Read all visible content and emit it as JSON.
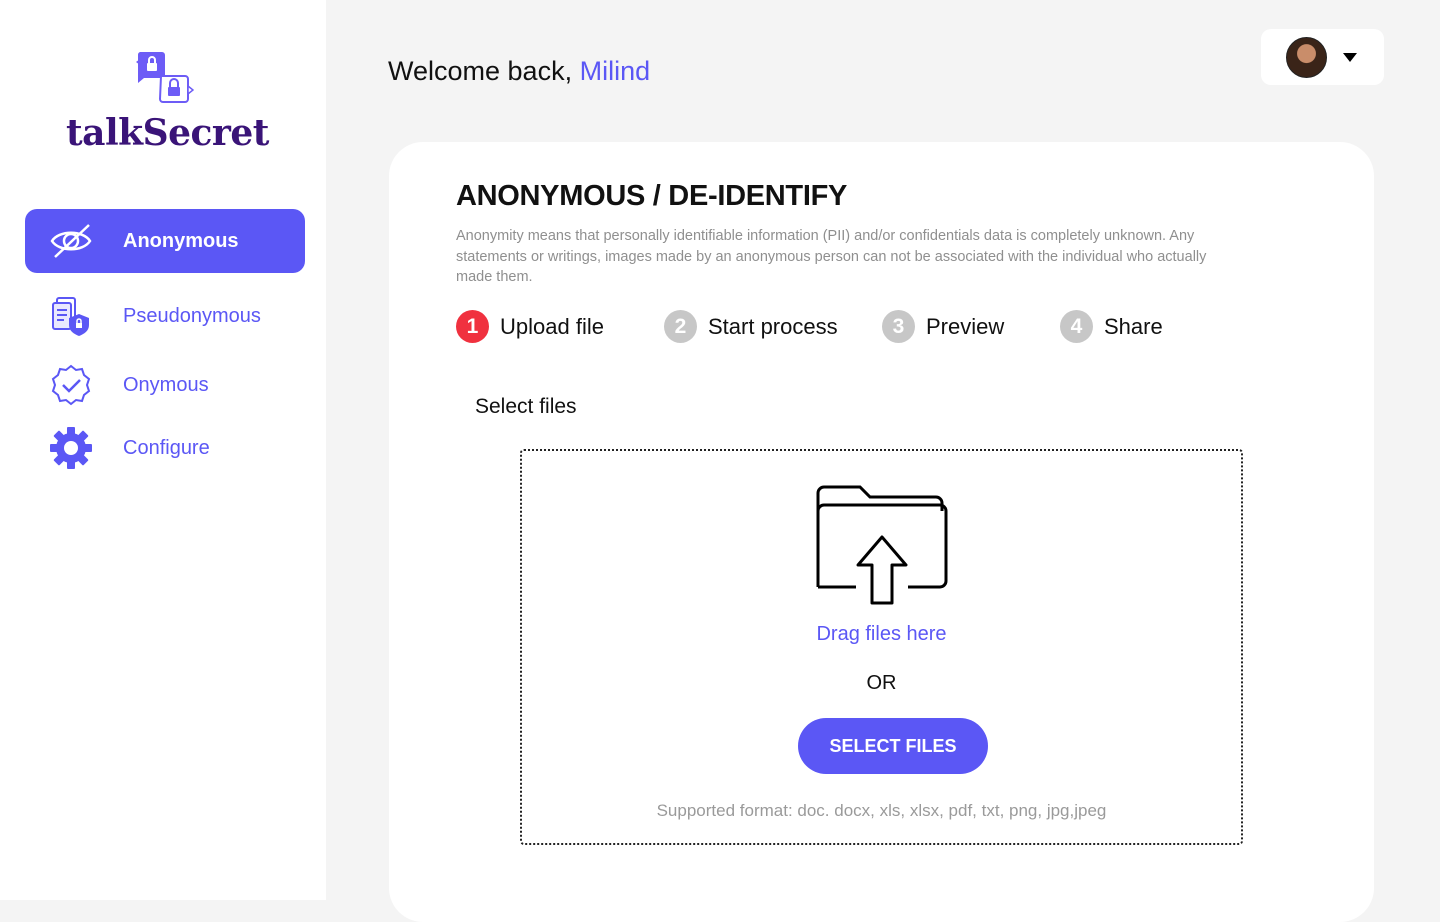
{
  "brand": {
    "name": "talkSecret",
    "color": "#3a1478"
  },
  "accent": "#5b57f5",
  "sidebar": {
    "items": [
      {
        "label": "Anonymous",
        "icon": "eye-slash-icon",
        "active": true
      },
      {
        "label": "Pseudonymous",
        "icon": "documents-shield-icon",
        "active": false
      },
      {
        "label": "Onymous",
        "icon": "verified-badge-icon",
        "active": false
      },
      {
        "label": "Configure",
        "icon": "gear-icon",
        "active": false
      }
    ]
  },
  "header": {
    "welcome": "Welcome back,",
    "user_name": "Milind",
    "avatar_icon": "user-avatar",
    "menu_icon": "caret-down-icon"
  },
  "main": {
    "title": "ANONYMOUS / DE-IDENTIFY",
    "description": "Anonymity means that personally identifiable information (PII) and/or confidentials data is completely unknown. Any statements or writings, images made by an anonymous person can not be associated with the individual who actually made them.",
    "steps": [
      {
        "number": "1",
        "label": "Upload file",
        "active": true
      },
      {
        "number": "2",
        "label": "Start process",
        "active": false
      },
      {
        "number": "3",
        "label": "Preview",
        "active": false
      },
      {
        "number": "4",
        "label": "Share",
        "active": false
      }
    ],
    "select_files_label": "Select files",
    "dropzone": {
      "icon": "folder-upload-icon",
      "drag_text": "Drag files here",
      "or_text": "OR",
      "button_label": "SELECT FILES",
      "supported_formats": "Supported format: doc. docx, xls, xlsx, pdf, txt, png, jpg,jpeg"
    }
  },
  "colors": {
    "step_active": "#f0313f",
    "step_inactive": "#c7c7c7"
  }
}
